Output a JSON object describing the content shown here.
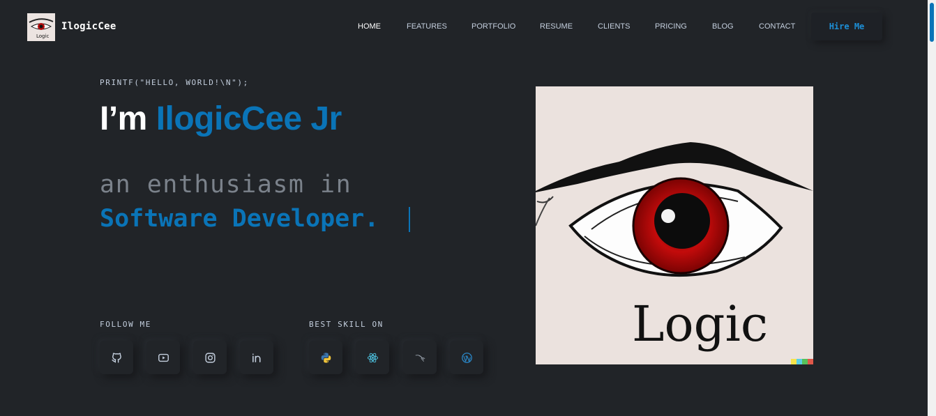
{
  "brand": {
    "name": "IlogicCee"
  },
  "nav": {
    "items": [
      {
        "label": "HOME",
        "active": true
      },
      {
        "label": "FEATURES"
      },
      {
        "label": "PORTFOLIO"
      },
      {
        "label": "RESUME"
      },
      {
        "label": "CLIENTS"
      },
      {
        "label": "PRICING"
      },
      {
        "label": "BLOG"
      },
      {
        "label": "CONTACT"
      }
    ],
    "hire_label": "Hire Me"
  },
  "hero": {
    "intro": "PRINTF(\"HELLO, WORLD!\\N\");",
    "title_prefix": "I’m ",
    "title_name": "IlogicCee Jr",
    "subtitle_line1": "an enthusiasm in",
    "subtitle_line2": "Software Developer."
  },
  "follow": {
    "title": "FOLLOW ME",
    "icons": [
      "github-icon",
      "youtube-icon",
      "instagram-icon",
      "linkedin-icon"
    ]
  },
  "skills": {
    "title": "BEST SKILL ON",
    "icons": [
      "python-icon",
      "react-icon",
      "kali-linux-icon",
      "wordpress-icon"
    ]
  },
  "image": {
    "text": "Logic"
  },
  "colors": {
    "accent": "#0a74b7",
    "background": "#212428",
    "text": "#c4cfde"
  }
}
